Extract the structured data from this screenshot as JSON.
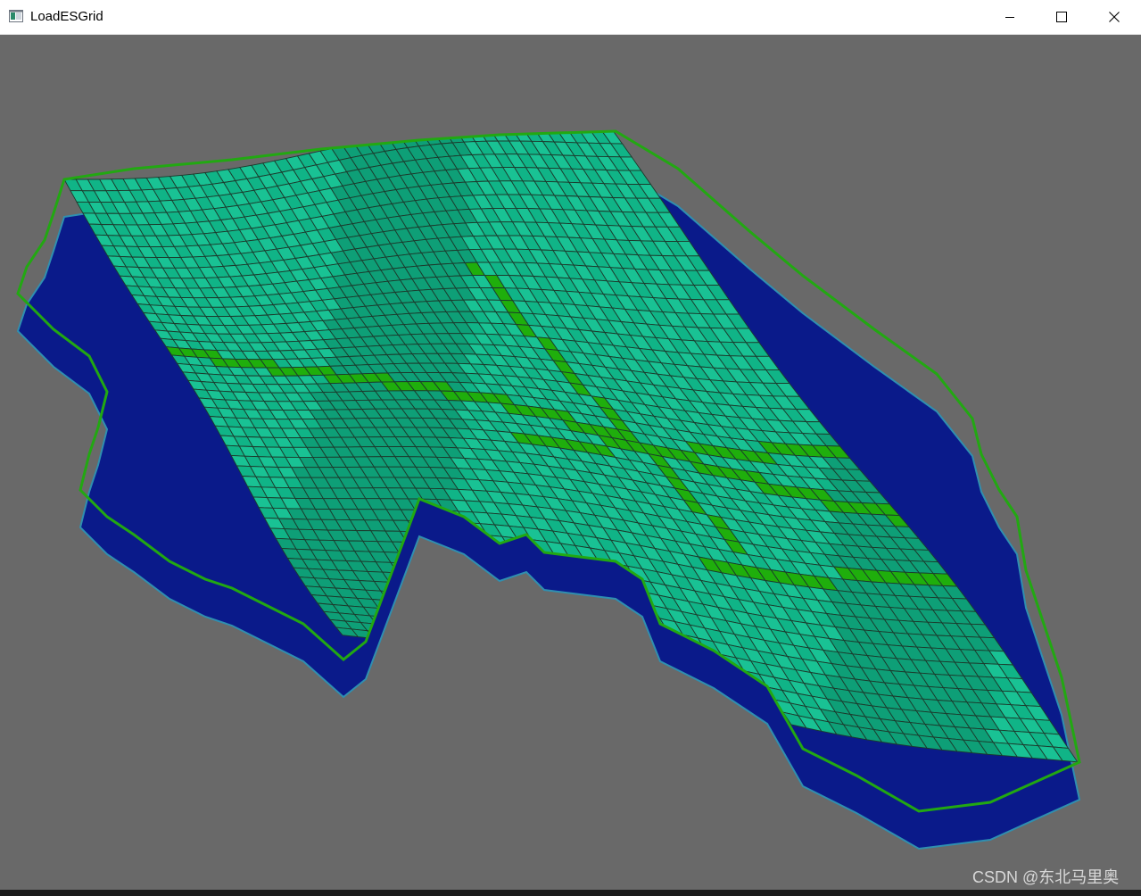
{
  "window": {
    "title": "LoadESGrid",
    "controls": {
      "minimize": "minimize-icon",
      "maximize": "maximize-icon",
      "close": "close-icon"
    }
  },
  "viewport": {
    "background": "#696969",
    "scene": "3D corner-point grid surface",
    "colors": {
      "surface_main": "#10b487",
      "surface_alt": "#19c294",
      "fault_cells": "#1fae0c",
      "grid_lines": "#1c3a2c",
      "side_walls": "#0a1a8a",
      "side_edge": "#2f8fb0"
    }
  },
  "watermark": {
    "text": "CSDN @东北马里奥"
  }
}
